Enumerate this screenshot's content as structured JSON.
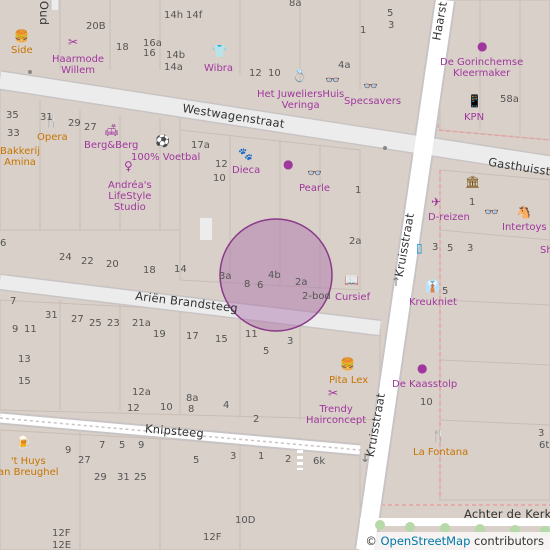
{
  "map": {
    "streets": {
      "westwagenstraat": "Westwagenstraat",
      "gasthuisstraat": "Gasthuisstr",
      "arien_brandsteeg": "Ariën Brandsteeg",
      "kruisstraat_upper": "Kruisstraat",
      "kruisstraat_lower": "Kruisstraat",
      "knipsteeg": "Knipsteeg",
      "achter_de_kerk": "Achter de Kerk",
      "haarstraat": "Haarst",
      "oude": "Oud"
    },
    "pois": {
      "side": "Side",
      "haarmode": "Haarmode\nWillem",
      "wibra": "Wibra",
      "juwelier": "Het JuweliersHuis\nVeringa",
      "specsavers": "Specsavers",
      "kleermaker": "De Gorinchemse\nKleermaker",
      "kpn": "KPN",
      "opera": "Opera",
      "bakkerij": "Bakkerij\nAmina",
      "bergberg": "Berg&Berg",
      "voetbal": "100% Voetbal",
      "andrea": "Andréa's\nLifeStyle\nStudio",
      "dieca": "Dieca",
      "pearle": "Pearle",
      "dreizen": "D-reizen",
      "intertoys": "Intertoys",
      "cursief": "Cursief",
      "kreukniet": "Kreukniet",
      "pitalex": "Pita Lex",
      "trendy": "Trendy\nHairconcept",
      "kaasstolp": "De Kaasstolp",
      "lafontana": "La Fontana",
      "huisbreughel": "'t Huys\nan Breughel",
      "sh": "Sh"
    },
    "house_numbers": [
      "20B",
      "18",
      "16a",
      "16",
      "14h",
      "14f",
      "14b",
      "14a",
      "8a",
      "5",
      "3",
      "1",
      "12",
      "10",
      "4a",
      "58a",
      "35",
      "33",
      "31",
      "29",
      "27",
      "17a",
      "12",
      "10",
      "1",
      "2a",
      "24",
      "22",
      "20",
      "18",
      "14",
      "3a",
      "8",
      "6",
      "4b",
      "2a",
      "2-bod",
      "5",
      "3",
      "6",
      "5",
      "7",
      "31",
      "27",
      "25",
      "23",
      "21a",
      "9",
      "11",
      "13",
      "15",
      "19",
      "17",
      "15",
      "11",
      "3",
      "5",
      "12a",
      "12",
      "10",
      "8a",
      "8",
      "4",
      "2",
      "10",
      "3",
      "7",
      "5",
      "9",
      "27",
      "29",
      "31",
      "25",
      "9",
      "5",
      "3",
      "1",
      "2",
      "6k",
      "6t",
      "12E",
      "12F",
      "10D",
      "1",
      "3",
      "3"
    ],
    "highlight": "location-circle",
    "attribution_prefix": "© ",
    "attribution_link": "OpenStreetMap",
    "attribution_suffix": " contributors"
  },
  "colors": {
    "road": "#ffffff",
    "road_casing": "#c9c4c4",
    "building": "#d9d0c9",
    "block": "#e0dfdf",
    "poi": "#a0379e",
    "food": "#c77400",
    "highlight_fill": "rgba(170,110,170,0.45)",
    "highlight_stroke": "#8a3a8a"
  }
}
